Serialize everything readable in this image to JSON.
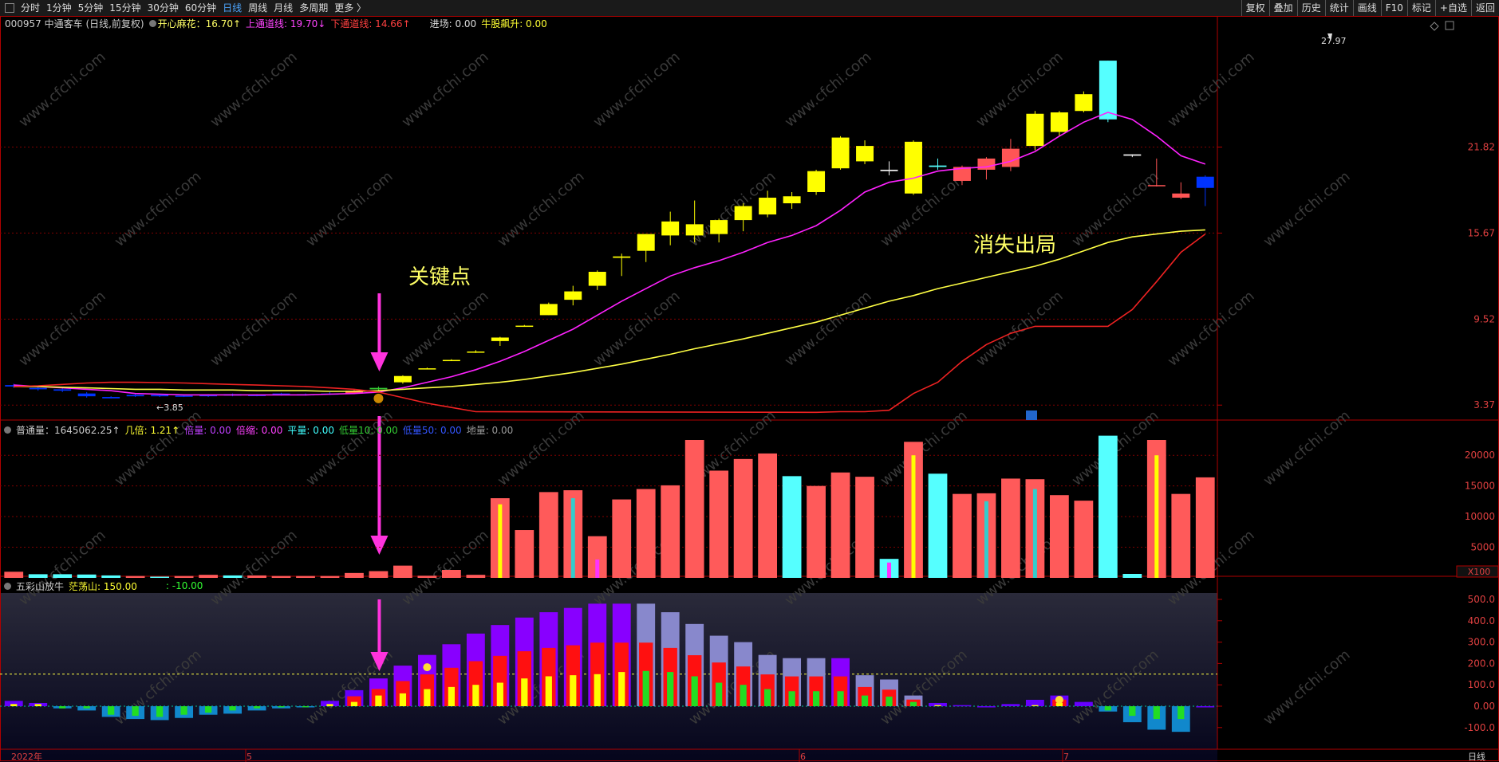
{
  "toolbar": {
    "periods": [
      "分时",
      "1分钟",
      "5分钟",
      "15分钟",
      "30分钟",
      "60分钟",
      "日线",
      "周线",
      "月线",
      "多周期",
      "更多 〉"
    ],
    "active": "日线",
    "right": [
      "复权",
      "叠加",
      "历史",
      "统计",
      "画线",
      "F10",
      "标记",
      "+自选",
      "返回"
    ]
  },
  "main_header": {
    "stock": "000957 中通客车 (日线,前复权)",
    "indicator": "开心麻花：16.70↑",
    "upper": "上通道线: 19.70↓",
    "lower": "下通道线: 14.66↑",
    "entry": "进场: 0.00",
    "bull": "牛股飙升: 0.00"
  },
  "vol_header": {
    "total": "普通量：1645062.25↑",
    "ratio": "几倍: 1.21↑",
    "b1": "倍量: 0.00",
    "b2": "倍缩: 0.00",
    "b3": "平量: 0.00",
    "b4": "低量10: 0.00",
    "b5": "低量50: 0.00",
    "b6": "地量: 0.00"
  },
  "ind_header": {
    "name": "五彩山放牛",
    "v1": "茫荡山: 150.00",
    "v2": ": -10.00"
  },
  "annotations": {
    "key_point": "关键点",
    "exit": "消失出局",
    "high": "27.97",
    "low": "←3.85"
  },
  "watermark": "www.cfchi.com",
  "x_axis": {
    "year": "2022年",
    "m5": "5",
    "m6": "6",
    "m7": "7",
    "period": "日线",
    "scale": "X100"
  },
  "chart_data": [
    {
      "type": "candlestick",
      "y_ticks": [
        21.82,
        15.67,
        9.52,
        3.37
      ],
      "y_labels": [
        "21.82",
        "15.67",
        "9.52",
        "3.37"
      ],
      "high": 27.97,
      "low": 3.85,
      "series": [
        "开心麻花",
        "上通道线",
        "下通道线"
      ]
    },
    {
      "type": "bar",
      "name": "普通量",
      "y_ticks": [
        20000,
        15000,
        10000,
        5000
      ],
      "y_labels": [
        "20000",
        "15000",
        "10000",
        "5000"
      ],
      "values": [
        1000,
        600,
        600,
        550,
        400,
        300,
        200,
        300,
        500,
        400,
        400,
        300,
        300,
        300,
        800,
        1100,
        2000,
        350,
        1300,
        500,
        13000,
        7800,
        14000,
        14300,
        6800,
        12800,
        14500,
        15100,
        22500,
        17500,
        19400,
        20300,
        16600,
        15000,
        17200,
        16500,
        3100,
        22200,
        17000,
        13700,
        13800,
        16200,
        16100,
        13500,
        12600,
        23200,
        650,
        22500,
        13700,
        16400
      ],
      "colors": [
        "r",
        "c",
        "c",
        "c",
        "c",
        "r",
        "c",
        "r",
        "r",
        "c",
        "r",
        "r",
        "r",
        "r",
        "r",
        "r",
        "r",
        "r",
        "r",
        "r",
        "r",
        "r",
        "r",
        "r",
        "r",
        "r",
        "r",
        "r",
        "r",
        "r",
        "r",
        "r",
        "c",
        "r",
        "r",
        "r",
        "c",
        "r",
        "c",
        "r",
        "r",
        "r",
        "r",
        "r",
        "r",
        "c",
        "c",
        "r",
        "r",
        "r"
      ]
    },
    {
      "type": "bar",
      "name": "五彩山放牛",
      "y_ticks": [
        500,
        400,
        300,
        200,
        100,
        0,
        -100
      ],
      "y_labels": [
        "500.0",
        "400.0",
        "300.0",
        "200.0",
        "100.0",
        "0.00",
        "-100.0"
      ],
      "threshold": 150,
      "values": [
        25,
        15,
        -10,
        -20,
        -50,
        -60,
        -65,
        -55,
        -40,
        -35,
        -20,
        -10,
        -5,
        25,
        75,
        130,
        190,
        240,
        290,
        340,
        380,
        415,
        440,
        460,
        480,
        480,
        480,
        440,
        385,
        330,
        300,
        240,
        225,
        225,
        225,
        145,
        125,
        50,
        15,
        5,
        0,
        10,
        30,
        50,
        20,
        -25,
        -75,
        -110,
        -120,
        0
      ],
      "inner": [
        10,
        10,
        -10,
        -10,
        -40,
        -45,
        -50,
        -40,
        -30,
        -20,
        -10,
        -5,
        -5,
        10,
        20,
        50,
        60,
        80,
        90,
        100,
        110,
        130,
        140,
        145,
        150,
        160,
        165,
        160,
        140,
        110,
        100,
        80,
        70,
        70,
        70,
        50,
        45,
        20,
        5,
        0,
        0,
        0,
        5,
        15,
        0,
        -20,
        -45,
        -60,
        -60,
        0
      ]
    }
  ]
}
